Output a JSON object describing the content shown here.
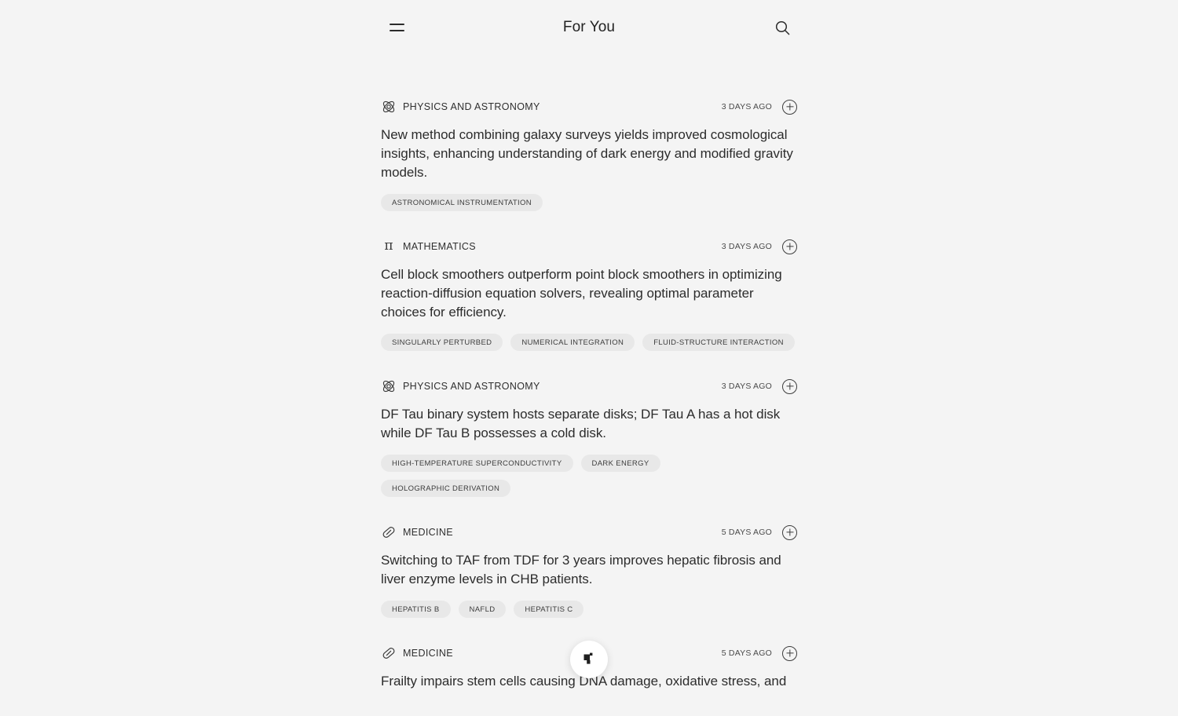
{
  "header": {
    "title": "For You",
    "menu_icon": "hamburger-menu-icon",
    "search_icon": "search-icon"
  },
  "fab": {
    "icon": "sparkle-flag-icon",
    "label": ""
  },
  "feed": {
    "cards": [
      {
        "category": "PHYSICS AND ASTRONOMY",
        "category_icon": "atom-icon",
        "timestamp": "3 DAYS AGO",
        "add_icon": "plus-circle-icon",
        "body": "New method combining galaxy surveys yields improved cosmological insights, enhancing understanding of dark energy and modified gravity models.",
        "tags": [
          "ASTRONOMICAL INSTRUMENTATION"
        ]
      },
      {
        "category": "MATHEMATICS",
        "category_icon": "pi-icon",
        "timestamp": "3 DAYS AGO",
        "add_icon": "plus-circle-icon",
        "body": "Cell block smoothers outperform point block smoothers in optimizing reaction-diffusion equation solvers, revealing optimal parameter choices for efficiency.",
        "tags": [
          "SINGULARLY PERTURBED",
          "NUMERICAL INTEGRATION",
          "FLUID-STRUCTURE INTERACTION"
        ]
      },
      {
        "category": "PHYSICS AND ASTRONOMY",
        "category_icon": "atom-icon",
        "timestamp": "3 DAYS AGO",
        "add_icon": "plus-circle-icon",
        "body": "DF Tau binary system hosts separate disks; DF Tau A has a hot disk while DF Tau B possesses a cold disk.",
        "tags": [
          "HIGH-TEMPERATURE SUPERCONDUCTIVITY",
          "DARK ENERGY",
          "HOLOGRAPHIC DERIVATION"
        ]
      },
      {
        "category": "MEDICINE",
        "category_icon": "pill-icon",
        "timestamp": "5 DAYS AGO",
        "add_icon": "plus-circle-icon",
        "body": "Switching to TAF from TDF for 3 years improves hepatic fibrosis and liver enzyme levels in CHB patients.",
        "tags": [
          "HEPATITIS B",
          "NAFLD",
          "HEPATITIS C"
        ]
      },
      {
        "category": "MEDICINE",
        "category_icon": "pill-icon",
        "timestamp": "5 DAYS AGO",
        "add_icon": "plus-circle-icon",
        "body": "Frailty impairs stem cells causing DNA damage, oxidative stress, and",
        "tags": []
      }
    ]
  },
  "colors": {
    "background": "#f4f4f4",
    "tag_background": "#e8e8e8",
    "text": "#2c2c2c",
    "fab_background": "#ffffff"
  }
}
